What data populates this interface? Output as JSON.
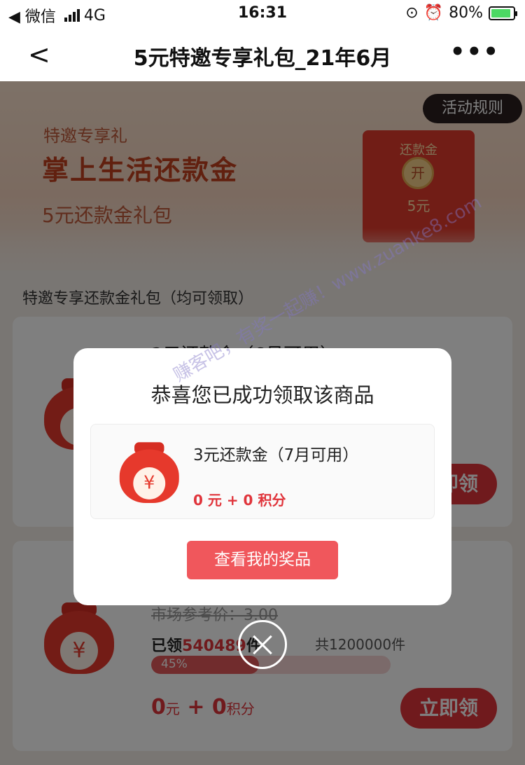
{
  "status": {
    "carrier": "◀ 微信",
    "network": "4G",
    "time": "16:31",
    "battery": "80%",
    "battery_level": 0.8
  },
  "nav": {
    "title": "5元特邀专享礼包_21年6月",
    "back_icon": "chevron-left-icon",
    "more_icon": "more-icon"
  },
  "banner": {
    "rules": "活动规则",
    "subtitle": "特邀专享礼",
    "title": "掌上生活还款金",
    "gift": "5元还款金礼包",
    "envelope_title": "还款金",
    "envelope_coin": "开",
    "envelope_value": "5元"
  },
  "section": {
    "title": "特邀专享还款金礼包（均可领取）"
  },
  "cards": [
    {
      "head": "2元还款金（6月可用）",
      "button": "立即领"
    },
    {
      "price": "市场参考价：3.00",
      "claimed_prefix": "已领",
      "claimed_count": "540489",
      "claimed_suffix": "件",
      "total": "共1200000件",
      "progress_label": "45%",
      "progress": 0.45,
      "cost_num1": "0",
      "cost_unit1": "元",
      "cost_plus": "+",
      "cost_num2": "0",
      "cost_unit2": "积分",
      "button": "立即领"
    }
  ],
  "modal": {
    "title": "恭喜您已成功领取该商品",
    "prize_name": "3元还款金（7月可用）",
    "prize_cost": "0 元 + 0 积分",
    "button": "查看我的奖品"
  },
  "watermark": "赚客吧，有奖一起赚！www.zuanke8.com",
  "colors": {
    "accent": "#e0343b",
    "modal_button": "#f0575c"
  }
}
